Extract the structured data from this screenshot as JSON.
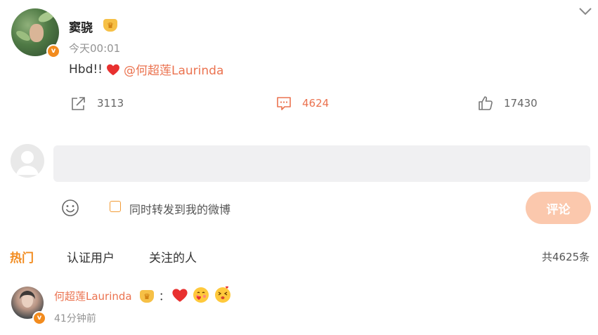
{
  "post": {
    "username": "窦骁",
    "timestamp": "今天00:01",
    "text_prefix": "Hbd!!",
    "mention": "@何超莲Laurinda",
    "verified_badge": "v",
    "actions": {
      "share_count": "3113",
      "comment_count": "4624",
      "like_count": "17430"
    }
  },
  "composer": {
    "input_value": "",
    "repost_label": "同时转发到我的微博",
    "submit_label": "评论"
  },
  "tabs": {
    "hot": "热门",
    "verified": "认证用户",
    "following": "关注的人"
  },
  "total_count": "共4625条",
  "comment": {
    "username": "何超莲Laurinda",
    "colon": "：",
    "time": "41分钟前",
    "verified_badge": "v",
    "emojis": [
      "heart-emoji",
      "blushing-heart-emoji",
      "kissing-emoji"
    ]
  },
  "colors": {
    "accent": "#eb7350",
    "tab_active": "#f28b1e",
    "submit_bg": "#fbc8ad",
    "input_bg": "#f0f0f2",
    "verified": "#f28b1e"
  }
}
